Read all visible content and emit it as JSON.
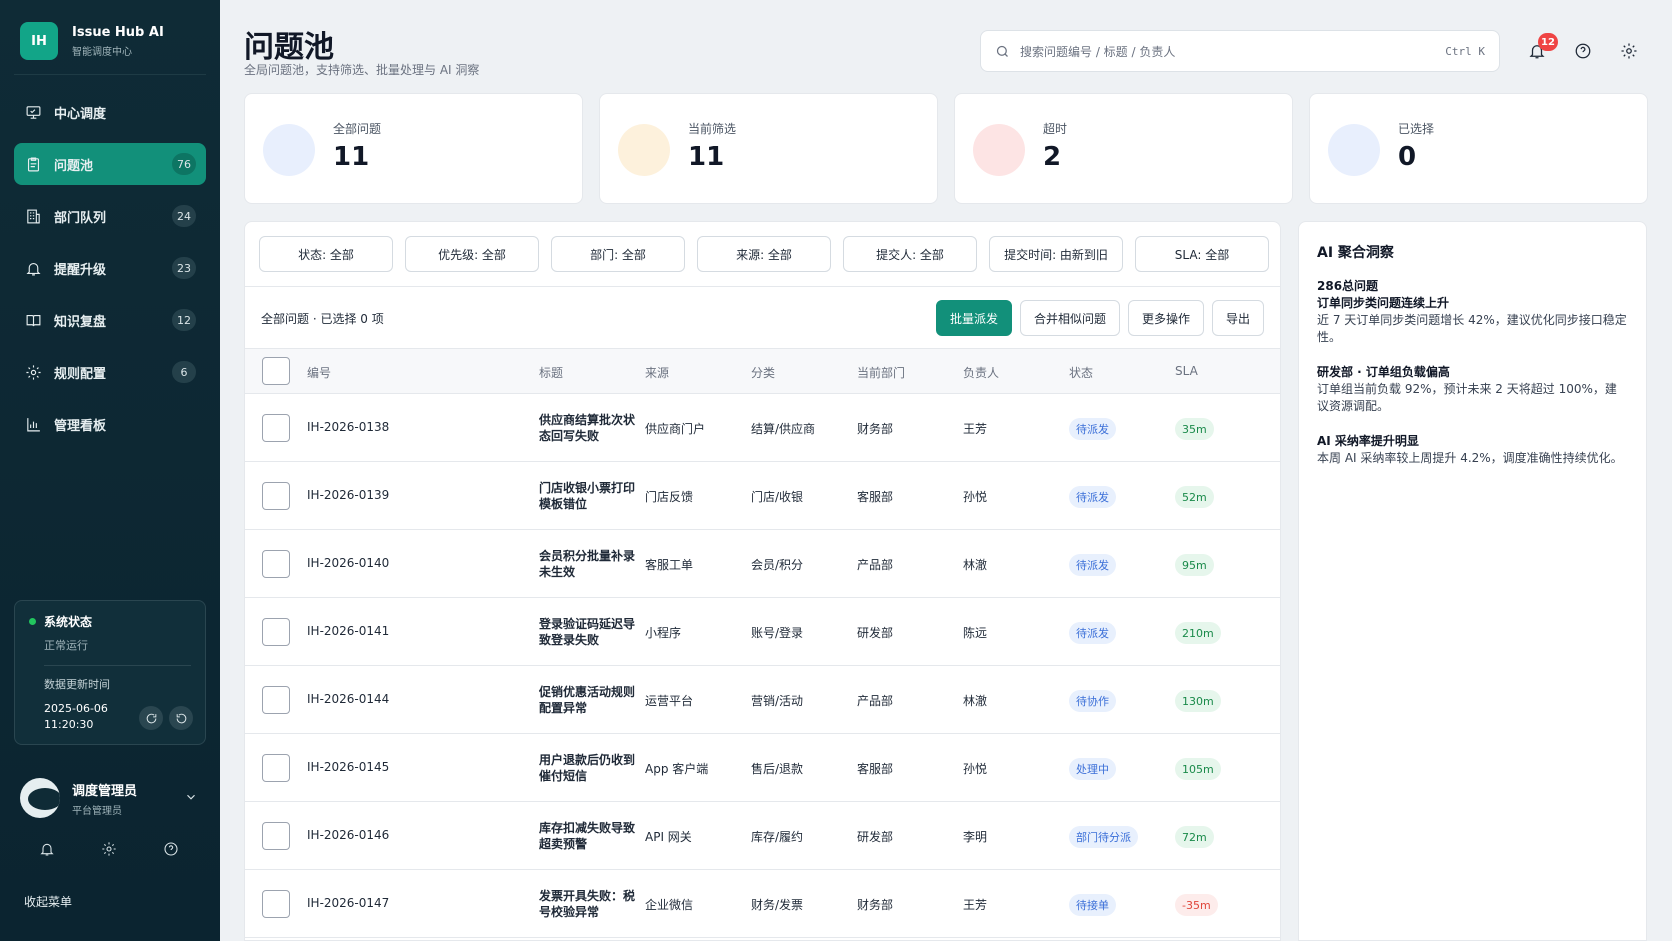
{
  "brand": {
    "logo": "IH",
    "name": "Issue Hub AI",
    "sub": "智能调度中心"
  },
  "nav": [
    {
      "label": "中心调度",
      "icon": "monitor-icon",
      "badge": ""
    },
    {
      "label": "问题池",
      "icon": "clipboard-icon",
      "badge": "76"
    },
    {
      "label": "部门队列",
      "icon": "building-icon",
      "badge": "24"
    },
    {
      "label": "提醒升级",
      "icon": "bell-icon",
      "badge": "23"
    },
    {
      "label": "知识复盘",
      "icon": "book-icon",
      "badge": "12"
    },
    {
      "label": "规则配置",
      "icon": "gear-icon",
      "badge": "6"
    },
    {
      "label": "管理看板",
      "icon": "bar-chart-icon",
      "badge": ""
    }
  ],
  "system": {
    "title": "系统状态",
    "status": "正常运行",
    "updated_label": "数据更新时间",
    "updated_time": "2025-06-06 11:20:30"
  },
  "user": {
    "name": "调度管理员",
    "role": "平台管理员"
  },
  "collapse_label": "收起菜单",
  "header": {
    "title": "问题池",
    "subtitle": "全局问题池，支持筛选、批量处理与 AI 洞察",
    "search_placeholder": "搜索问题编号 / 标题 / 负责人",
    "search_shortcut": "Ctrl K",
    "notif_count": "12"
  },
  "stats": [
    {
      "label": "全部问题",
      "value": "11",
      "color": "#e8effd"
    },
    {
      "label": "当前筛选",
      "value": "11",
      "color": "#fdf1dc"
    },
    {
      "label": "超时",
      "value": "2",
      "color": "#fde4e4"
    },
    {
      "label": "已选择",
      "value": "0",
      "color": "#e8effd"
    }
  ],
  "filters": [
    "状态: 全部",
    "优先级: 全部",
    "部门: 全部",
    "来源: 全部",
    "提交人: 全部",
    "提交时间: 由新到旧",
    "SLA: 全部"
  ],
  "selection_info": "全部问题 · 已选择 0 项",
  "actions": {
    "dispatch": "批量派发",
    "merge": "合并相似问题",
    "more": "更多操作",
    "export": "导出"
  },
  "columns": {
    "id": "编号",
    "title": "标题",
    "source": "来源",
    "category": "分类",
    "dept": "当前部门",
    "owner": "负责人",
    "status": "状态",
    "sla": "SLA"
  },
  "rows": [
    {
      "id": "IH-2026-0138",
      "title": "供应商结算批次状态回写失败",
      "source": "供应商门户",
      "category": "结算/供应商",
      "dept": "财务部",
      "owner": "王芳",
      "status": "待派发",
      "sla": "35m",
      "overdue": false
    },
    {
      "id": "IH-2026-0139",
      "title": "门店收银小票打印模板错位",
      "source": "门店反馈",
      "category": "门店/收银",
      "dept": "客服部",
      "owner": "孙悦",
      "status": "待派发",
      "sla": "52m",
      "overdue": false
    },
    {
      "id": "IH-2026-0140",
      "title": "会员积分批量补录未生效",
      "source": "客服工单",
      "category": "会员/积分",
      "dept": "产品部",
      "owner": "林澈",
      "status": "待派发",
      "sla": "95m",
      "overdue": false
    },
    {
      "id": "IH-2026-0141",
      "title": "登录验证码延迟导致登录失败",
      "source": "小程序",
      "category": "账号/登录",
      "dept": "研发部",
      "owner": "陈远",
      "status": "待派发",
      "sla": "210m",
      "overdue": false
    },
    {
      "id": "IH-2026-0144",
      "title": "促销优惠活动规则配置异常",
      "source": "运营平台",
      "category": "营销/活动",
      "dept": "产品部",
      "owner": "林澈",
      "status": "待协作",
      "sla": "130m",
      "overdue": false
    },
    {
      "id": "IH-2026-0145",
      "title": "用户退款后仍收到催付短信",
      "source": "App 客户端",
      "category": "售后/退款",
      "dept": "客服部",
      "owner": "孙悦",
      "status": "处理中",
      "sla": "105m",
      "overdue": false
    },
    {
      "id": "IH-2026-0146",
      "title": "库存扣减失败导致超卖预警",
      "source": "API 网关",
      "category": "库存/履约",
      "dept": "研发部",
      "owner": "李明",
      "status": "部门待分派",
      "sla": "72m",
      "overdue": false
    },
    {
      "id": "IH-2026-0147",
      "title": "发票开具失败：税号校验异常",
      "source": "企业微信",
      "category": "财务/发票",
      "dept": "财务部",
      "owner": "王芳",
      "status": "待接单",
      "sla": "-35m",
      "overdue": true
    }
  ],
  "insight": {
    "title": "AI 聚合洞察",
    "blocks": [
      {
        "lead": "286总问题",
        "heading": "订单同步类问题连续上升",
        "text": "近 7 天订单同步类问题增长 42%，建议优化同步接口稳定性。"
      },
      {
        "lead": "",
        "heading": "研发部 · 订单组负载偏高",
        "text": "订单组当前负载 92%，预计未来 2 天将超过 100%，建议资源调配。"
      },
      {
        "lead": "",
        "heading": "AI 采纳率提升明显",
        "text": "本周 AI 采纳率较上周提升 4.2%，调度准确性持续优化。"
      }
    ]
  }
}
